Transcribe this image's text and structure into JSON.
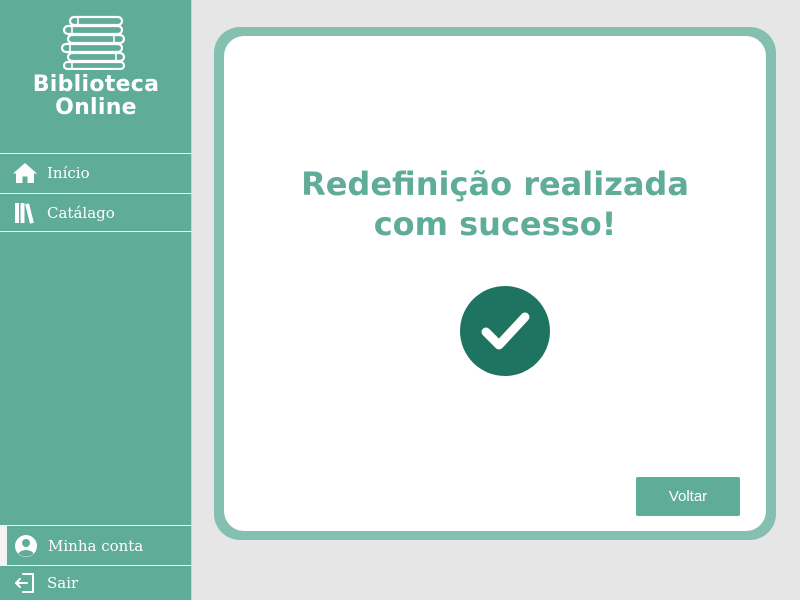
{
  "sidebar": {
    "brand_line1": "Biblioteca",
    "brand_line2": "Online",
    "logo_icon": "books-stack-icon",
    "nav": [
      {
        "label": "Início",
        "icon": "home-icon"
      },
      {
        "label": "Catálago",
        "icon": "books-icon"
      }
    ],
    "account": {
      "label": "Minha conta",
      "icon": "user-circle-icon"
    },
    "logout": {
      "label": "Sair",
      "icon": "logout-icon"
    }
  },
  "main": {
    "headline_line1": "Redefinição realizada",
    "headline_line2": "com sucesso!",
    "status_icon": "check-circle-icon",
    "back_label": "Voltar"
  },
  "colors": {
    "sidebar_bg": "#5fac98",
    "panel_border": "#84bfb0",
    "accent_text": "#5fac98",
    "check_bg": "#1f7461",
    "page_bg": "#e6e6e6"
  }
}
